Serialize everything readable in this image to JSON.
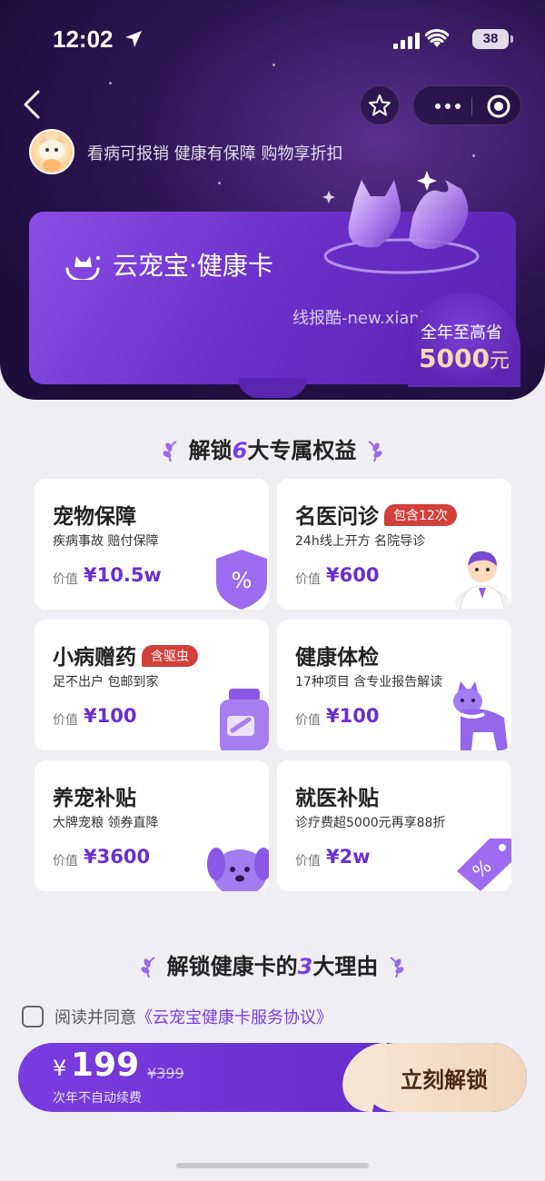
{
  "status_bar": {
    "time": "12:02",
    "battery": "38"
  },
  "header": {
    "slogan": "看病可报销 健康有保障 购物享折扣",
    "card_brand": "云宠宝·健康卡",
    "watermark": "线报酷-new.xianbao.fun",
    "save_line1": "全年至高省",
    "save_amount": "5000",
    "save_unit": "元"
  },
  "benefits": {
    "title_pre": "解锁",
    "title_num": "6",
    "title_post": "大专属权益",
    "value_label": "价值",
    "items": [
      {
        "name": "宠物保障",
        "tag": "",
        "desc": "疾病事故 赔付保障",
        "value": "¥10.5w"
      },
      {
        "name": "名医问诊",
        "tag": "包含12次",
        "desc": "24h线上开方 名院导诊",
        "value": "¥600"
      },
      {
        "name": "小病赠药",
        "tag": "含驱虫",
        "desc": "足不出户 包邮到家",
        "value": "¥100"
      },
      {
        "name": "健康体检",
        "tag": "",
        "desc": "17种项目 含专业报告解读",
        "value": "¥100"
      },
      {
        "name": "养宠补贴",
        "tag": "",
        "desc": "大牌宠粮 领券直降",
        "value": "¥3600"
      },
      {
        "name": "就医补贴",
        "tag": "",
        "desc": "诊疗费超5000元再享88折",
        "value": "¥2w"
      }
    ]
  },
  "reasons": {
    "title_pre": "解锁健康卡的",
    "title_num": "3",
    "title_post": "大理由"
  },
  "agreement": {
    "text": "阅读并同意",
    "link": "《云宠宝健康卡服务协议》"
  },
  "purchase": {
    "currency": "¥",
    "price": "199",
    "original": "¥399",
    "note": "次年不自动续费",
    "cta": "立刻解锁"
  },
  "colors": {
    "accent": "#7a3de0",
    "header_bg": "#2e1554",
    "tag_red": "#d1413a",
    "cta_bg": "#f7e5d3"
  }
}
